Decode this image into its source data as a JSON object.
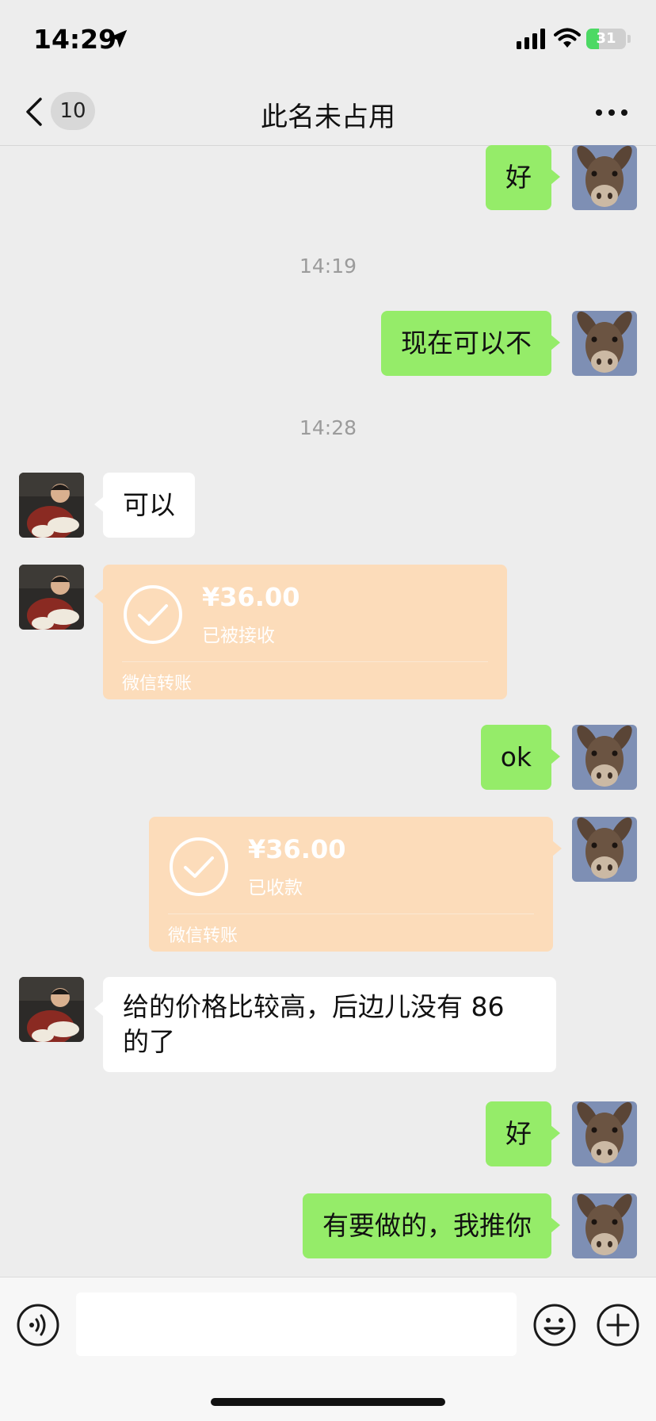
{
  "status_bar": {
    "time": "14:29",
    "battery": "31",
    "battery_level": 0.31,
    "icons": [
      "location-arrow-icon",
      "cellular-signal-icon",
      "wifi-icon",
      "charging-battery-icon"
    ]
  },
  "nav": {
    "back_icon": "chevron-left-icon",
    "unread_count": "10",
    "title": "此名未占用",
    "more_icon": "more-dots-icon"
  },
  "messages": [
    {
      "type": "text",
      "side": "out",
      "text": "好"
    },
    {
      "type": "time",
      "text": "14:19"
    },
    {
      "type": "text",
      "side": "out",
      "text": "现在可以不"
    },
    {
      "type": "time",
      "text": "14:28"
    },
    {
      "type": "text",
      "side": "in",
      "text": "可以"
    },
    {
      "type": "transfer",
      "side": "in",
      "amount": "¥36.00",
      "status": "已被接收",
      "label": "微信转账"
    },
    {
      "type": "text",
      "side": "out",
      "text": "ok"
    },
    {
      "type": "transfer",
      "side": "out",
      "amount": "¥36.00",
      "status": "已收款",
      "label": "微信转账"
    },
    {
      "type": "text",
      "side": "in",
      "text": "给的价格比较高，后边儿没有 86 的了"
    },
    {
      "type": "text",
      "side": "out",
      "text": "好"
    },
    {
      "type": "text",
      "side": "out",
      "text": "有要做的，我推你"
    }
  ],
  "input_bar": {
    "voice_icon": "voice-icon",
    "input_value": "",
    "emoji_icon": "emoji-icon",
    "plus_icon": "plus-icon"
  },
  "colors": {
    "background": "#ededed",
    "outgoing_bubble": "#95ec69",
    "incoming_bubble": "#ffffff",
    "transfer_card": "#fcdcba",
    "timestamp": "#9b9b9b"
  }
}
